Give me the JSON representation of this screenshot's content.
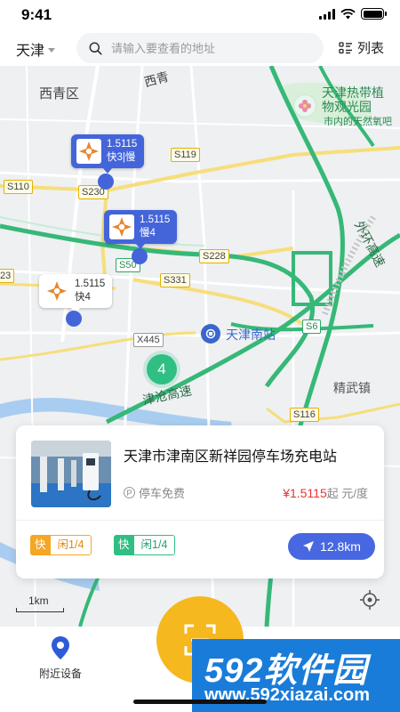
{
  "status_bar": {
    "time": "9:41"
  },
  "header": {
    "city": "天津",
    "search_placeholder": "请输入要查看的地址",
    "list_label": "列表"
  },
  "map": {
    "area_labels": {
      "xiqing": "西青区",
      "xiqing_top": "西青",
      "tianjin_south_station": "天津南站",
      "jingwu_town": "精武镇",
      "tianjin_tropical_1": "天津热带植",
      "tianjin_tropical_2": "物观光园",
      "tianjin_tropical_3": "市内的天然氧吧",
      "jincang_expressway": "津沧高速",
      "outer_ring": "外环高速"
    },
    "road_signs": {
      "s119": "S119",
      "s110": "S110",
      "s230": "S230",
      "s50": "S50",
      "s228": "S228",
      "s331": "S331",
      "x445": "X445",
      "s6": "S6",
      "s116": "S116",
      "s23": "23"
    },
    "markers": [
      {
        "price": "1.5115",
        "status": "快3|慢"
      },
      {
        "price": "1.5115",
        "status": "慢4"
      },
      {
        "price": "1.5115",
        "status": "快4"
      }
    ],
    "cluster_count": "4",
    "scale_label": "1km"
  },
  "station_card": {
    "name": "天津市津南区新祥园停车场充电站",
    "parking_label": "停车免费",
    "price": "¥1.5115",
    "price_suffix": "起 元/度",
    "fast_tag": {
      "kind": "快",
      "state": "闲1/4"
    },
    "slow_tag": {
      "kind": "快",
      "state": "闲1/4"
    },
    "distance": "12.8km"
  },
  "tab_bar": {
    "nearby_label": "附近设备"
  },
  "watermark": {
    "brand": "592软件园",
    "url": "www.592xiazai.com"
  },
  "colors": {
    "primary": "#4465d9",
    "accent_green": "#2fbf83",
    "price_red": "#e63434",
    "tag_orange": "#f5a623",
    "tag_green": "#2fbf83",
    "scan_yellow": "#f5b81e",
    "watermark_blue": "#1a7cd9"
  }
}
